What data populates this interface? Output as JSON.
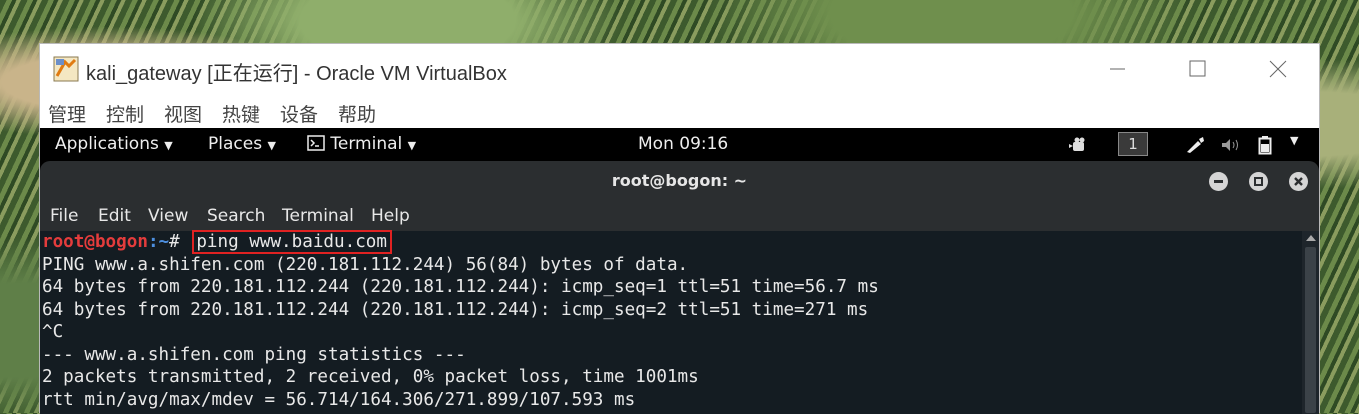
{
  "host_window": {
    "title": "kali_gateway [正在运行] - Oracle VM VirtualBox",
    "menu": [
      "管理",
      "控制",
      "视图",
      "热键",
      "设备",
      "帮助"
    ]
  },
  "guest_topbar": {
    "applications": "Applications",
    "places": "Places",
    "terminal": "Terminal",
    "clock": "Mon 09:16",
    "workspace": "1"
  },
  "terminal": {
    "title": "root@bogon: ~",
    "menu": [
      "File",
      "Edit",
      "View",
      "Search",
      "Terminal",
      "Help"
    ],
    "prompt_user": "root@bogon",
    "prompt_path": ":~",
    "prompt_symbol": "# ",
    "command": "ping www.baidu.com",
    "output": [
      "PING www.a.shifen.com (220.181.112.244) 56(84) bytes of data.",
      "64 bytes from 220.181.112.244 (220.181.112.244): icmp_seq=1 ttl=51 time=56.7 ms",
      "64 bytes from 220.181.112.244 (220.181.112.244): icmp_seq=2 ttl=51 time=271 ms",
      "^C",
      "--- www.a.shifen.com ping statistics ---",
      "2 packets transmitted, 2 received, 0% packet loss, time 1001ms",
      "rtt min/avg/max/mdev = 56.714/164.306/271.899/107.593 ms"
    ]
  }
}
